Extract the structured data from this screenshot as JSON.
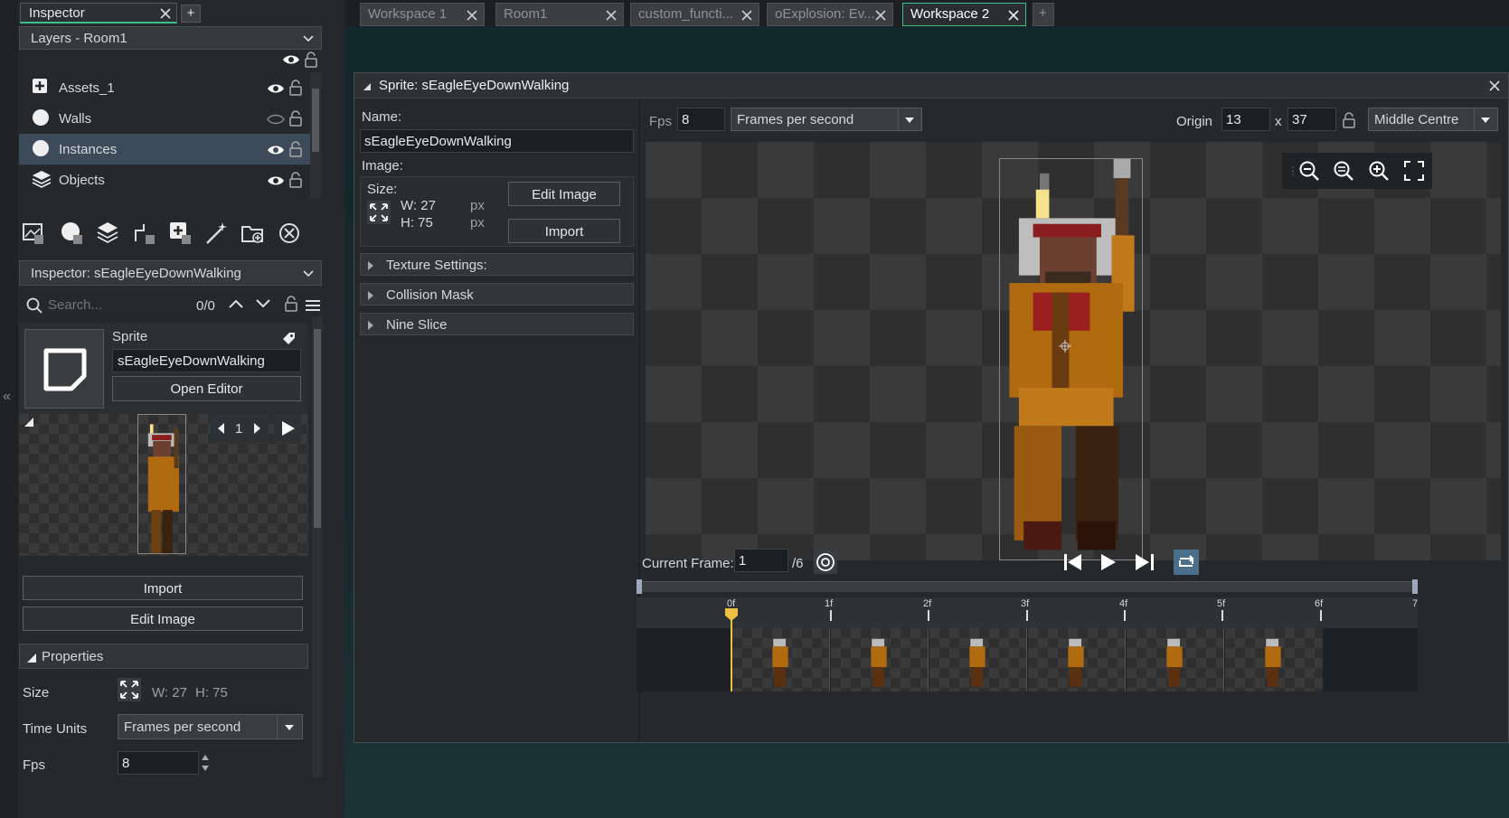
{
  "inspector_tab": {
    "label": "Inspector"
  },
  "layers": {
    "header": "Layers - Room1",
    "items": [
      {
        "label": "Assets_1"
      },
      {
        "label": "Walls"
      },
      {
        "label": "Instances"
      },
      {
        "label": "Objects"
      }
    ]
  },
  "inspector": {
    "header": "Inspector: sEagleEyeDownWalking",
    "search_placeholder": "Search...",
    "search_count": "0/0",
    "sprite_label": "Sprite",
    "sprite_name": "sEagleEyeDownWalking",
    "open_editor": "Open Editor",
    "frame_number": "1",
    "import_label": "Import",
    "edit_image_label": "Edit Image",
    "properties_label": "Properties",
    "size_label": "Size",
    "size_w": "W: 27",
    "size_h": "H: 75",
    "time_units_label": "Time Units",
    "time_units_value": "Frames per second",
    "fps_label": "Fps",
    "fps_value": "8"
  },
  "workspace_tabs": [
    {
      "label": "Workspace 1"
    },
    {
      "label": "Room1"
    },
    {
      "label": "custom_functi..."
    },
    {
      "label": "oExplosion: Ev..."
    },
    {
      "label": "Workspace 2"
    }
  ],
  "sprite_editor": {
    "title": "Sprite: sEagleEyeDownWalking",
    "name_label": "Name:",
    "name_value": "sEagleEyeDownWalking",
    "image_label": "Image:",
    "size_label": "Size:",
    "w_value": "W: 27",
    "h_value": "H: 75",
    "px": "px",
    "edit_image": "Edit Image",
    "import": "Import",
    "sections": [
      {
        "label": "Texture Settings:"
      },
      {
        "label": "Collision Mask"
      },
      {
        "label": "Nine Slice"
      }
    ],
    "fps_label": "Fps",
    "fps_value": "8",
    "time_units": "Frames per second",
    "origin_label": "Origin",
    "origin_x": "13",
    "origin_x_label": "x",
    "origin_y": "37",
    "origin_preset": "Middle Centre",
    "current_frame_label": "Current Frame:",
    "current_frame_value": "1",
    "frame_total": "/6",
    "timeline_marks": [
      "0f",
      "1f",
      "2f",
      "3f",
      "4f",
      "5f",
      "6f",
      "7"
    ]
  },
  "colors": {
    "accent": "#3cc08c",
    "playhead": "#f0c040",
    "selection": "#3d4a59"
  }
}
